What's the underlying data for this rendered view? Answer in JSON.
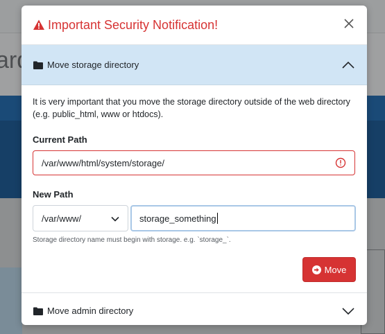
{
  "background": {
    "partial_heading": "ard"
  },
  "modal": {
    "title": "Important Security Notification!",
    "title_icon": "warning-triangle-icon",
    "close_icon": "close-icon",
    "colors": {
      "danger": "#d63333",
      "accordion_open_bg": "#d1e5f5",
      "focus_border": "#a8c7e6"
    }
  },
  "accordion": [
    {
      "label": "Move storage directory",
      "icon": "folder-icon",
      "expanded": true,
      "description": "It is very important that you move the storage directory outside of the web directory (e.g. public_html, www or htdocs).",
      "current_path_label": "Current Path",
      "current_path_value": "/var/www/html/system/storage/",
      "new_path_label": "New Path",
      "new_path_select_value": "/var/www/",
      "new_path_input_value": "storage_something",
      "help_text": "Storage directory name must begin with storage. e.g. `storage_`.",
      "move_button_label": "Move"
    },
    {
      "label": "Move admin directory",
      "icon": "folder-icon",
      "expanded": false
    }
  ]
}
